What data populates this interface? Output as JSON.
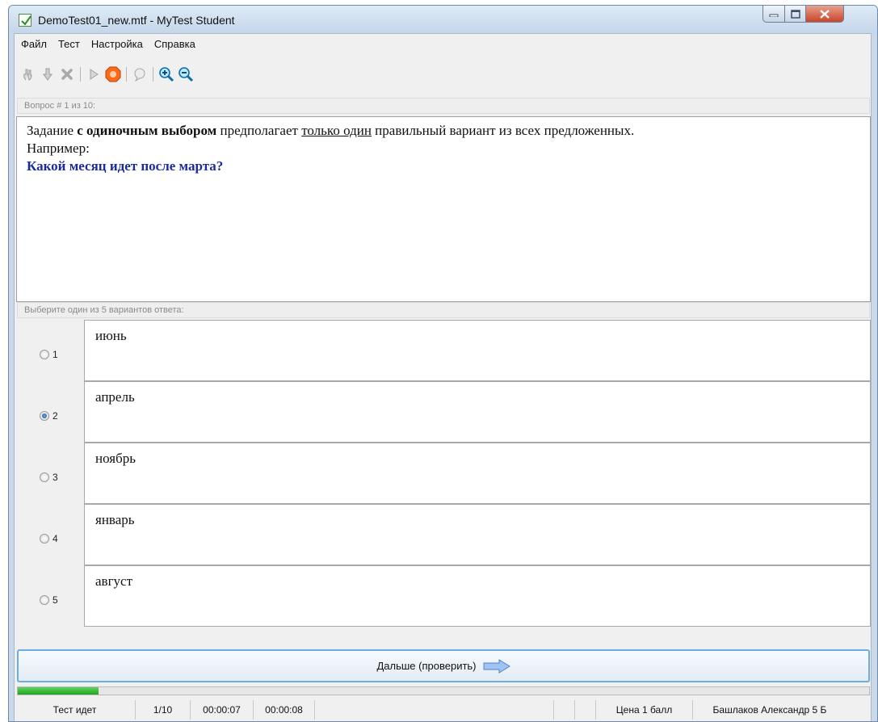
{
  "window": {
    "title": "DemoTest01_new.mtf - MyTest Student"
  },
  "menu": [
    {
      "label": "Файл"
    },
    {
      "label": "Тест"
    },
    {
      "label": "Настройка"
    },
    {
      "label": "Справка"
    }
  ],
  "toolbar": {
    "icons": [
      "hand-icon",
      "thumbs-down-icon",
      "close-icon",
      "play-icon",
      "stop-icon",
      "speech-icon",
      "zoom-in-icon",
      "zoom-out-icon"
    ]
  },
  "question": {
    "label": "Вопрос # 1 из 10:",
    "text_1": "Задание ",
    "text_bold": "с одиночным выбором",
    "text_2": " предполагает ",
    "text_underline": "только один",
    "text_3": " правильный вариант из всех предложенных.",
    "line_2": "Например:",
    "highlight": "Какой месяц идет после марта?"
  },
  "answers_label": "Выберите один из 5 вариантов ответа:",
  "answers": [
    {
      "num": "1",
      "text": "июнь",
      "selected": false
    },
    {
      "num": "2",
      "text": "апрель",
      "selected": true
    },
    {
      "num": "3",
      "text": "ноябрь",
      "selected": false
    },
    {
      "num": "4",
      "text": "январь",
      "selected": false
    },
    {
      "num": "5",
      "text": "август",
      "selected": false
    }
  ],
  "next_button": {
    "label": "Дальше (проверить)"
  },
  "progress": {
    "fraction": 0.095
  },
  "status": {
    "state": "Тест идет",
    "position": "1/10",
    "time_1": "00:00:07",
    "time_2": "00:00:08",
    "price": "Цена 1 балл",
    "user": "Башлаков Александр 5 Б"
  },
  "colors": {
    "highlight": "#1c2aa0",
    "accent": "#6aaee0",
    "progress": "#1fa31f"
  }
}
